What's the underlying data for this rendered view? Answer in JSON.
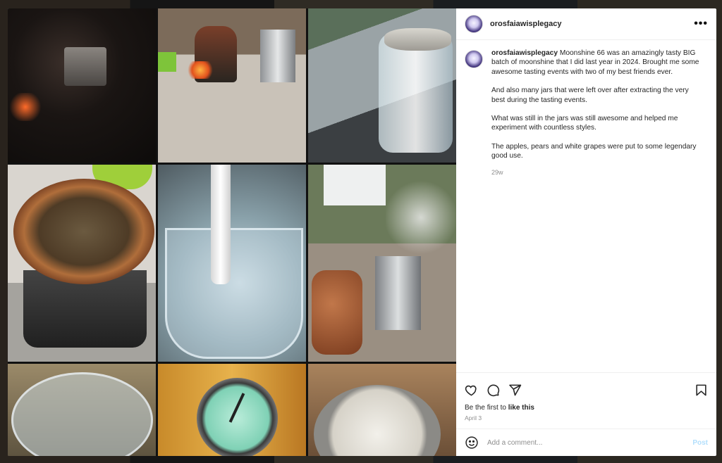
{
  "post": {
    "username": "orosfaiawisplegacy",
    "more_label": "•••",
    "caption": {
      "username": "orosfaiawisplegacy",
      "paragraphs": [
        "Moonshine 66 was an amazingly tasty BIG batch of moonshine that I did last year in 2024. Brought me some awesome tasting events with two of my best friends ever.",
        "And also many jars that were left over after extracting the very best during the tasting events.",
        "What was still in the jars was still awesome and helped me experiment with countless styles.",
        "The apples, pears and white grapes were put to some legendary good use."
      ],
      "age": "29w"
    },
    "likes": {
      "prefix": "Be the first to ",
      "link": "like this"
    },
    "date": "April 3",
    "comment": {
      "placeholder": "Add a comment...",
      "post_label": "Post"
    }
  },
  "icons": {
    "like": "heart-icon",
    "comment": "speech-bubble-icon",
    "share": "paper-plane-icon",
    "save": "bookmark-icon",
    "emoji": "smiley-icon"
  },
  "colors": {
    "post_disabled": "#b2dffc",
    "muted": "#8e8e8e",
    "text": "#262626"
  }
}
